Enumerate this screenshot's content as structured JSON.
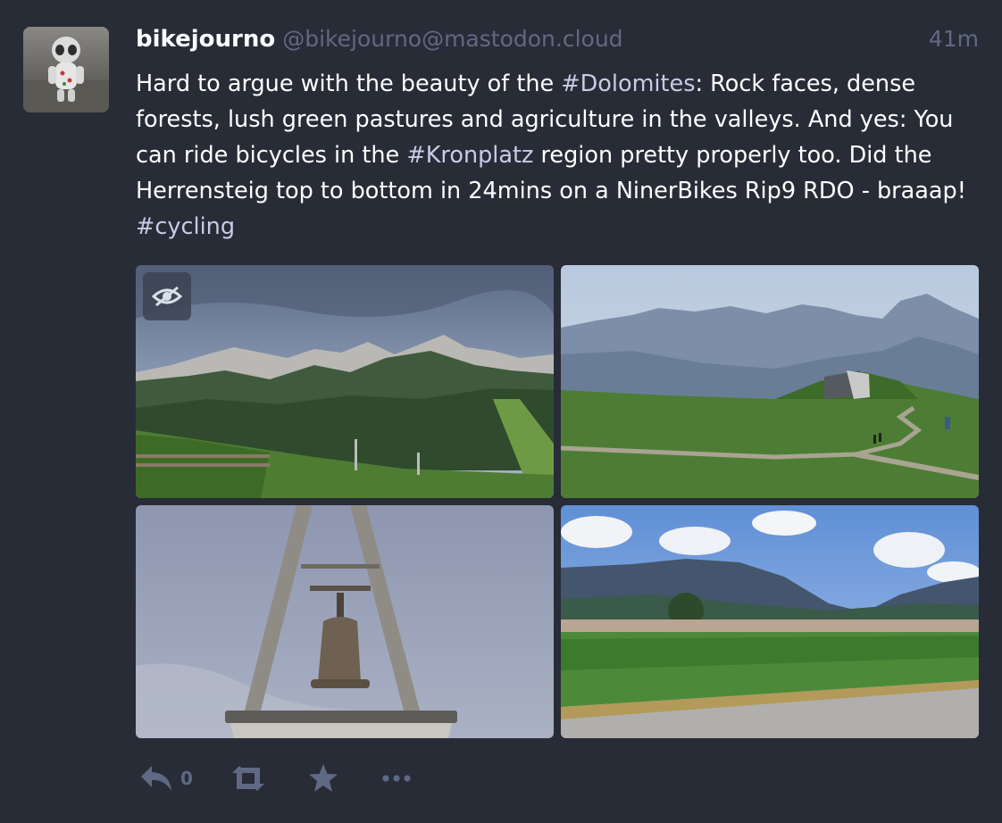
{
  "status": {
    "display_name": "bikejourno",
    "acct": "@bikejourno@mastodon.cloud",
    "time": "41m",
    "content": {
      "t1": "Hard to argue with the beauty of the ",
      "tag1": "#Dolomites",
      "t2": ": Rock faces, dense forests, lush green pastures and agriculture in the valleys. And yes: You can ride bicycles in the ",
      "tag2": "#Kronplatz",
      "t3": " region pretty properly too. Did the Herrensteig top to bottom in 24mins on a NinerBikes Rip9 RDO - braaap! ",
      "tag3": "#cycling"
    },
    "actions": {
      "reply_count": "0",
      "icons": [
        "reply-icon",
        "boost-icon",
        "favourite-icon",
        "more-icon"
      ]
    },
    "media_hide_icon": "eye-slash-icon"
  },
  "colors": {
    "background": "#282c37",
    "muted": "#606984",
    "text": "#ffffff",
    "hashtag": "#d9e1e8"
  }
}
